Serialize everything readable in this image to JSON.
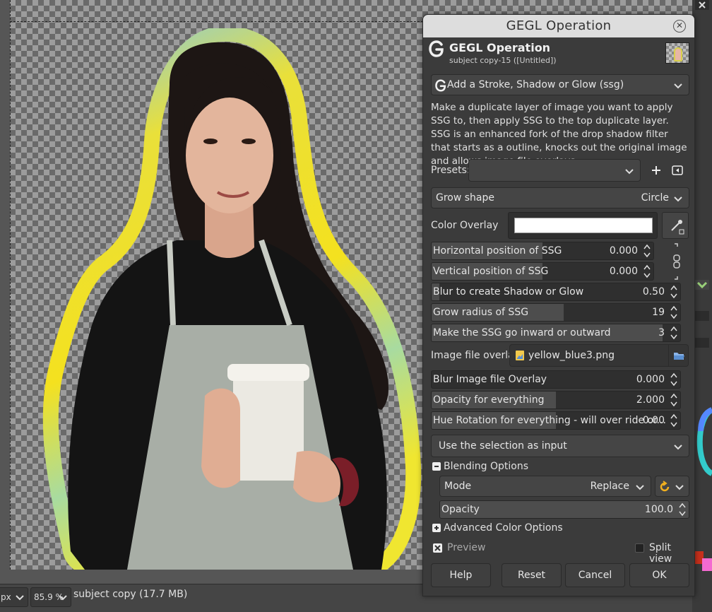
{
  "dialog": {
    "window_title": "GEGL Operation",
    "header_title": "GEGL Operation",
    "header_subtitle": "subject copy-15 ([Untitled])",
    "operation": "Add a Stroke, Shadow or Glow (ssg)",
    "description": "Make a duplicate layer of image you want to apply SSG to, then apply SSG to the top duplicate layer. SSG is an enhanced fork of the drop shadow filter that starts as a outline, knocks out the original image and allows image file overlays.",
    "presets_label": "Presets:",
    "presets_value": "",
    "grow_shape_label": "Grow shape",
    "grow_shape_value": "Circle",
    "color_overlay_label": "Color Overlay",
    "color_overlay_color": "#ffffff",
    "sliders": {
      "hpos": {
        "label": "Horizontal position of SSG",
        "value": "0.000",
        "fraction": 0.5
      },
      "vpos": {
        "label": "Vertical position of SSG",
        "value": "0.000",
        "fraction": 0.5
      },
      "blur": {
        "label": "Blur to create Shadow or Glow",
        "value": "0.50",
        "fraction": 0.03
      },
      "grow": {
        "label": "Grow radius of SSG",
        "value": "19",
        "fraction": 0.53
      },
      "inout": {
        "label": "Make the SSG go inward or outward",
        "value": "3",
        "fraction": 0.93
      },
      "blur_overlay": {
        "label": "Blur Image file Overlay",
        "value": "0.000",
        "fraction": 0.0
      },
      "opacity_all": {
        "label": "Opacity for everything",
        "value": "2.000",
        "fraction": 0.5
      },
      "hue_rotation": {
        "label": "Hue Rotation for everything - will over ride or...",
        "value": "0.00",
        "fraction": 0.5
      },
      "blend_opacity": {
        "label": "Opacity",
        "value": "100.0",
        "fraction": 1.0
      }
    },
    "image_overlay_label": "Image file overlay",
    "image_overlay_file": "yellow_blue3.png",
    "selection_input": "Use the selection as input",
    "blending_options_label": "Blending Options",
    "mode_label": "Mode",
    "mode_value": "Replace",
    "advanced_color_label": "Advanced Color Options",
    "preview_label": "Preview",
    "preview_checked": true,
    "split_view_label": "Split view",
    "split_view_checked": false,
    "buttons": {
      "help": "Help",
      "reset": "Reset",
      "cancel": "Cancel",
      "ok": "OK"
    }
  },
  "statusbar": {
    "unit": "px",
    "zoom": "85.9 %",
    "status": "subject copy (17.7 MB)"
  },
  "canvas": {
    "glow_colors": [
      "#7ec8ee",
      "#f4e11f",
      "#a8dba0"
    ]
  }
}
